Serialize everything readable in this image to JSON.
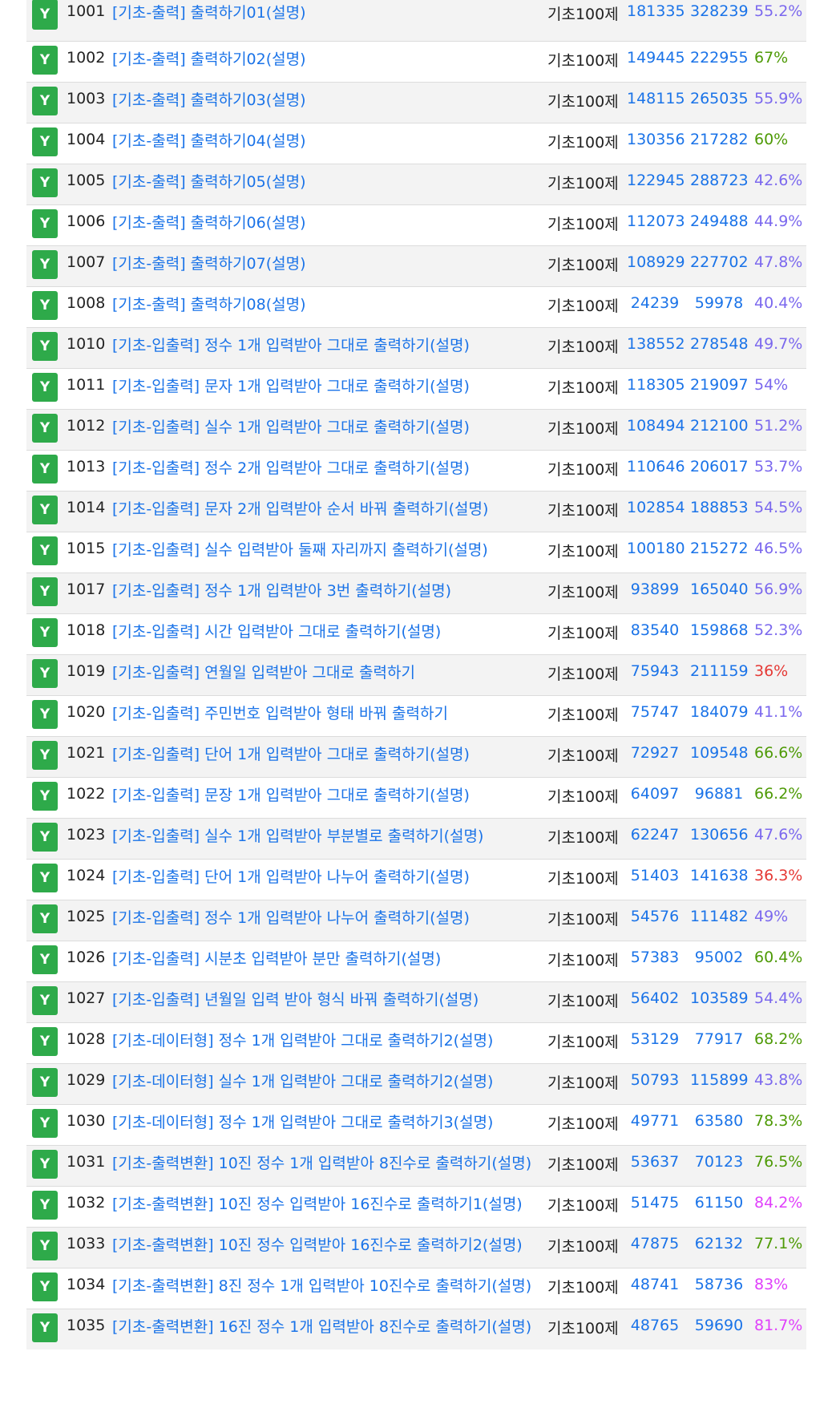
{
  "badge_label": "Y",
  "category_label": "기초100제",
  "colors": {
    "badge": "#2eaa4a",
    "link": "#1a73e8",
    "green": "#4e9a06",
    "blue": "#1a73e8",
    "purple": "#7b68ee",
    "red": "#e53935",
    "magenta": "#e040fb"
  },
  "problems": [
    {
      "id": "1001",
      "title": "[기초-출력] 출력하기01(설명)",
      "solved": "181335",
      "submitted": "328239",
      "rate": "55.2%",
      "rate_color": "#7b68ee"
    },
    {
      "id": "1002",
      "title": "[기초-출력] 출력하기02(설명)",
      "solved": "149445",
      "submitted": "222955",
      "rate": "67%",
      "rate_color": "#4e9a06"
    },
    {
      "id": "1003",
      "title": "[기초-출력] 출력하기03(설명)",
      "solved": "148115",
      "submitted": "265035",
      "rate": "55.9%",
      "rate_color": "#7b68ee"
    },
    {
      "id": "1004",
      "title": "[기초-출력] 출력하기04(설명)",
      "solved": "130356",
      "submitted": "217282",
      "rate": "60%",
      "rate_color": "#4e9a06"
    },
    {
      "id": "1005",
      "title": "[기초-출력] 출력하기05(설명)",
      "solved": "122945",
      "submitted": "288723",
      "rate": "42.6%",
      "rate_color": "#7b68ee"
    },
    {
      "id": "1006",
      "title": "[기초-출력] 출력하기06(설명)",
      "solved": "112073",
      "submitted": "249488",
      "rate": "44.9%",
      "rate_color": "#7b68ee"
    },
    {
      "id": "1007",
      "title": "[기초-출력] 출력하기07(설명)",
      "solved": "108929",
      "submitted": "227702",
      "rate": "47.8%",
      "rate_color": "#7b68ee"
    },
    {
      "id": "1008",
      "title": "[기초-출력] 출력하기08(설명)",
      "solved": "24239",
      "submitted": "59978",
      "rate": "40.4%",
      "rate_color": "#7b68ee"
    },
    {
      "id": "1010",
      "title": "[기초-입출력] 정수 1개 입력받아 그대로 출력하기(설명)",
      "solved": "138552",
      "submitted": "278548",
      "rate": "49.7%",
      "rate_color": "#7b68ee"
    },
    {
      "id": "1011",
      "title": "[기초-입출력] 문자 1개 입력받아 그대로 출력하기(설명)",
      "solved": "118305",
      "submitted": "219097",
      "rate": "54%",
      "rate_color": "#7b68ee"
    },
    {
      "id": "1012",
      "title": "[기초-입출력] 실수 1개 입력받아 그대로 출력하기(설명)",
      "solved": "108494",
      "submitted": "212100",
      "rate": "51.2%",
      "rate_color": "#7b68ee"
    },
    {
      "id": "1013",
      "title": "[기초-입출력] 정수 2개 입력받아 그대로 출력하기(설명)",
      "solved": "110646",
      "submitted": "206017",
      "rate": "53.7%",
      "rate_color": "#7b68ee"
    },
    {
      "id": "1014",
      "title": "[기초-입출력] 문자 2개 입력받아 순서 바꿔 출력하기(설명)",
      "solved": "102854",
      "submitted": "188853",
      "rate": "54.5%",
      "rate_color": "#7b68ee"
    },
    {
      "id": "1015",
      "title": "[기초-입출력] 실수 입력받아 둘째 자리까지 출력하기(설명)",
      "solved": "100180",
      "submitted": "215272",
      "rate": "46.5%",
      "rate_color": "#7b68ee"
    },
    {
      "id": "1017",
      "title": "[기초-입출력] 정수 1개 입력받아 3번 출력하기(설명)",
      "solved": "93899",
      "submitted": "165040",
      "rate": "56.9%",
      "rate_color": "#7b68ee"
    },
    {
      "id": "1018",
      "title": "[기초-입출력] 시간 입력받아 그대로 출력하기(설명)",
      "solved": "83540",
      "submitted": "159868",
      "rate": "52.3%",
      "rate_color": "#7b68ee"
    },
    {
      "id": "1019",
      "title": "[기초-입출력] 연월일 입력받아 그대로 출력하기",
      "solved": "75943",
      "submitted": "211159",
      "rate": "36%",
      "rate_color": "#e53935"
    },
    {
      "id": "1020",
      "title": "[기초-입출력] 주민번호 입력받아 형태 바꿔 출력하기",
      "solved": "75747",
      "submitted": "184079",
      "rate": "41.1%",
      "rate_color": "#7b68ee"
    },
    {
      "id": "1021",
      "title": "[기초-입출력] 단어 1개 입력받아 그대로 출력하기(설명)",
      "solved": "72927",
      "submitted": "109548",
      "rate": "66.6%",
      "rate_color": "#4e9a06"
    },
    {
      "id": "1022",
      "title": "[기초-입출력] 문장 1개 입력받아 그대로 출력하기(설명)",
      "solved": "64097",
      "submitted": "96881",
      "rate": "66.2%",
      "rate_color": "#4e9a06"
    },
    {
      "id": "1023",
      "title": "[기초-입출력] 실수 1개 입력받아 부분별로 출력하기(설명)",
      "solved": "62247",
      "submitted": "130656",
      "rate": "47.6%",
      "rate_color": "#7b68ee"
    },
    {
      "id": "1024",
      "title": "[기초-입출력] 단어 1개 입력받아 나누어 출력하기(설명)",
      "solved": "51403",
      "submitted": "141638",
      "rate": "36.3%",
      "rate_color": "#e53935"
    },
    {
      "id": "1025",
      "title": "[기초-입출력] 정수 1개 입력받아 나누어 출력하기(설명)",
      "solved": "54576",
      "submitted": "111482",
      "rate": "49%",
      "rate_color": "#7b68ee"
    },
    {
      "id": "1026",
      "title": "[기초-입출력] 시분초 입력받아 분만 출력하기(설명)",
      "solved": "57383",
      "submitted": "95002",
      "rate": "60.4%",
      "rate_color": "#4e9a06"
    },
    {
      "id": "1027",
      "title": "[기초-입출력] 년월일 입력 받아 형식 바꿔 출력하기(설명)",
      "solved": "56402",
      "submitted": "103589",
      "rate": "54.4%",
      "rate_color": "#7b68ee"
    },
    {
      "id": "1028",
      "title": "[기초-데이터형] 정수 1개 입력받아 그대로 출력하기2(설명)",
      "solved": "53129",
      "submitted": "77917",
      "rate": "68.2%",
      "rate_color": "#4e9a06"
    },
    {
      "id": "1029",
      "title": "[기초-데이터형] 실수 1개 입력받아 그대로 출력하기2(설명)",
      "solved": "50793",
      "submitted": "115899",
      "rate": "43.8%",
      "rate_color": "#7b68ee"
    },
    {
      "id": "1030",
      "title": "[기초-데이터형] 정수 1개 입력받아 그대로 출력하기3(설명)",
      "solved": "49771",
      "submitted": "63580",
      "rate": "78.3%",
      "rate_color": "#4e9a06"
    },
    {
      "id": "1031",
      "title": "[기초-출력변환] 10진 정수 1개 입력받아 8진수로 출력하기(설명)",
      "solved": "53637",
      "submitted": "70123",
      "rate": "76.5%",
      "rate_color": "#4e9a06"
    },
    {
      "id": "1032",
      "title": "[기초-출력변환] 10진 정수 입력받아 16진수로 출력하기1(설명)",
      "solved": "51475",
      "submitted": "61150",
      "rate": "84.2%",
      "rate_color": "#e040fb"
    },
    {
      "id": "1033",
      "title": "[기초-출력변환] 10진 정수 입력받아 16진수로 출력하기2(설명)",
      "solved": "47875",
      "submitted": "62132",
      "rate": "77.1%",
      "rate_color": "#4e9a06"
    },
    {
      "id": "1034",
      "title": "[기초-출력변환] 8진 정수 1개 입력받아 10진수로 출력하기(설명)",
      "solved": "48741",
      "submitted": "58736",
      "rate": "83%",
      "rate_color": "#e040fb"
    },
    {
      "id": "1035",
      "title": "[기초-출력변환] 16진 정수 1개 입력받아 8진수로 출력하기(설명)",
      "solved": "48765",
      "submitted": "59690",
      "rate": "81.7%",
      "rate_color": "#e040fb"
    }
  ]
}
